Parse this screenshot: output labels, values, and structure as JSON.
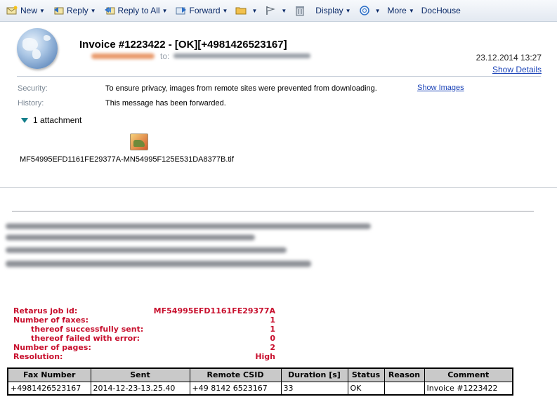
{
  "toolbar": {
    "new": "New",
    "reply": "Reply",
    "reply_all": "Reply to All",
    "forward": "Forward",
    "display": "Display",
    "more": "More",
    "dochouse": "DocHouse",
    "icons": [
      "new-mail-icon",
      "reply-icon",
      "reply-all-icon",
      "forward-icon",
      "folder-icon",
      "flag-icon",
      "trash-icon",
      "search-icon"
    ]
  },
  "header": {
    "subject": "Invoice #1223422 - [OK][+4981426523167]",
    "to_label": "to:",
    "date": "23.12.2014 13:27",
    "show_details": "Show Details"
  },
  "info": {
    "security_label": "Security:",
    "security_text": "To ensure privacy, images from remote sites were prevented from downloading.",
    "show_images": "Show Images",
    "history_label": "History:",
    "history_text": "This message has been forwarded."
  },
  "attachments": {
    "toggle": "1 attachment",
    "filename": "MF54995EFD1161FE29377A-MN54995F125E531DA8377B.tif"
  },
  "fax": {
    "job_id_label": "Retarus job id:",
    "job_id": "MF54995EFD1161FE29377A",
    "num_faxes_label": "Number of faxes:",
    "num_faxes": "1",
    "sent_label": "thereof successfully sent:",
    "sent": "1",
    "failed_label": "thereof failed with error:",
    "failed": "0",
    "pages_label": "Number of pages:",
    "pages": "2",
    "resolution_label": "Resolution:",
    "resolution": "High",
    "accent_color": "#c8102e"
  },
  "table": {
    "headers": [
      "Fax Number",
      "Sent",
      "Remote CSID",
      "Duration [s]",
      "Status",
      "Reason",
      "Comment"
    ],
    "rows": [
      [
        "+4981426523167",
        "2014-12-23-13.25.40",
        "+49 8142 6523167",
        "33",
        "OK",
        "",
        "Invoice #1223422"
      ]
    ]
  }
}
